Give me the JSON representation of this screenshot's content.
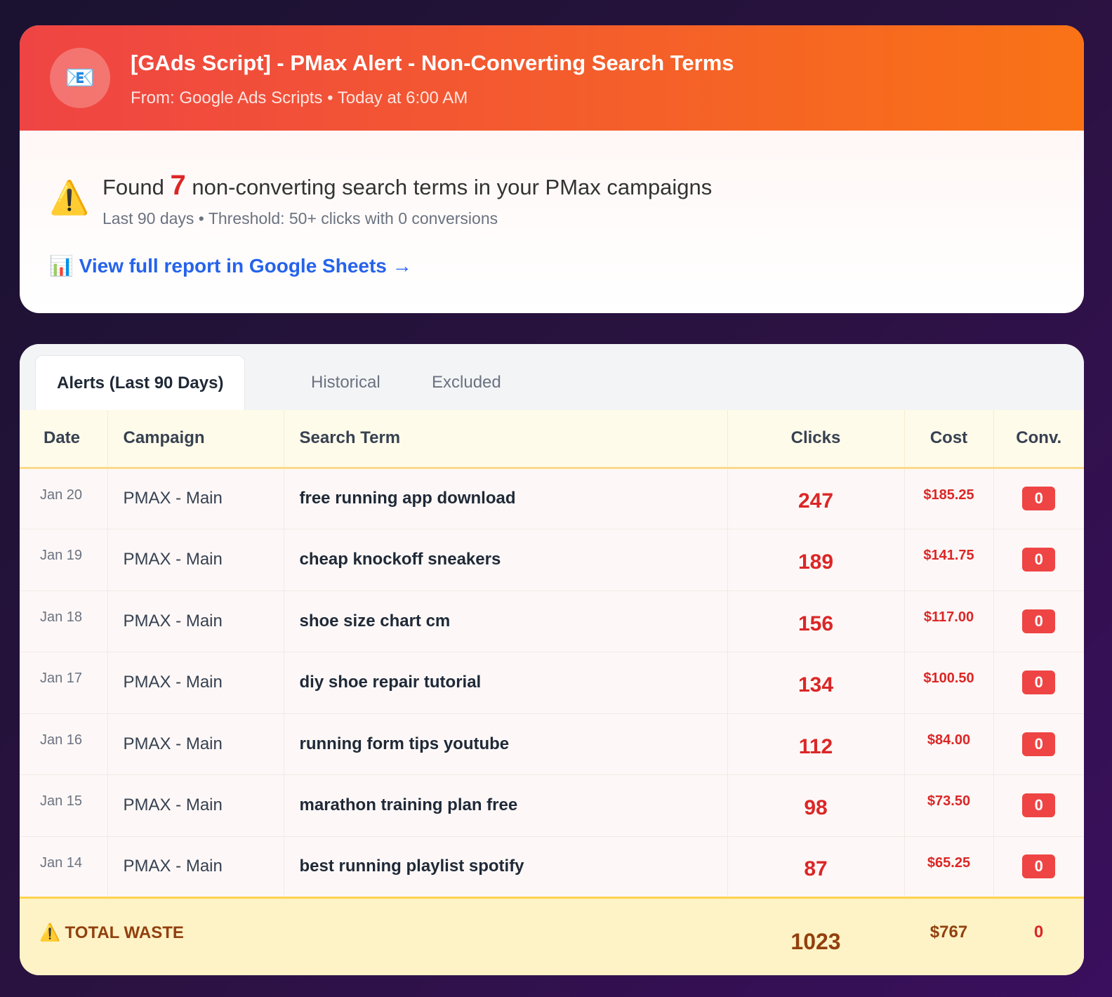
{
  "email": {
    "icon": "envelope-icon",
    "title": "[GAds Script] - PMax Alert - Non-Converting Search Terms",
    "from": "From: Google Ads Scripts • Today at 6:00 AM"
  },
  "summary": {
    "found_prefix": "Found",
    "count": "7",
    "found_suffix": "non-converting search terms in your PMax campaigns",
    "subtitle": "Last 90 days • Threshold: 50+ clicks with 0 conversions",
    "link": "📊 View full report in Google Sheets →"
  },
  "tabs": [
    "Alerts (Last 90 Days)",
    "Historical",
    "Excluded"
  ],
  "table": {
    "headers": [
      "Date",
      "Campaign",
      "Search Term",
      "Clicks",
      "Cost",
      "Conv."
    ],
    "rows": [
      {
        "date": "Jan 20",
        "campaign": "PMAX - Main",
        "term": "free running app download",
        "clicks": "247",
        "cost": "$185.25",
        "conv": "0"
      },
      {
        "date": "Jan 19",
        "campaign": "PMAX - Main",
        "term": "cheap knockoff sneakers",
        "clicks": "189",
        "cost": "$141.75",
        "conv": "0"
      },
      {
        "date": "Jan 18",
        "campaign": "PMAX - Main",
        "term": "shoe size chart cm",
        "clicks": "156",
        "cost": "$117.00",
        "conv": "0"
      },
      {
        "date": "Jan 17",
        "campaign": "PMAX - Main",
        "term": "diy shoe repair tutorial",
        "clicks": "134",
        "cost": "$100.50",
        "conv": "0"
      },
      {
        "date": "Jan 16",
        "campaign": "PMAX - Main",
        "term": "running form tips youtube",
        "clicks": "112",
        "cost": "$84.00",
        "conv": "0"
      },
      {
        "date": "Jan 15",
        "campaign": "PMAX - Main",
        "term": "marathon training plan free",
        "clicks": "98",
        "cost": "$73.50",
        "conv": "0"
      },
      {
        "date": "Jan 14",
        "campaign": "PMAX - Main",
        "term": "best running playlist spotify",
        "clicks": "87",
        "cost": "$65.25",
        "conv": "0"
      }
    ],
    "total": {
      "label": "⚠️ TOTAL WASTE",
      "clicks": "1023",
      "cost": "$767",
      "conv": "0"
    }
  }
}
